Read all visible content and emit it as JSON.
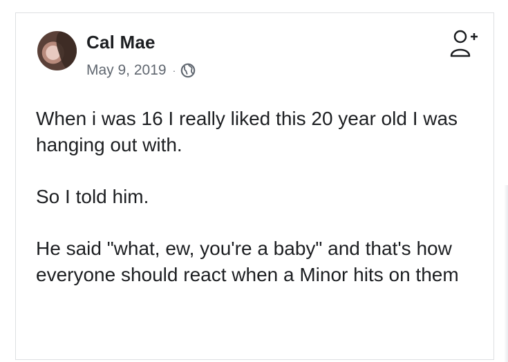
{
  "post": {
    "author": "Cal Mae",
    "date": "May 9, 2019",
    "separator": "·",
    "privacy_icon": "globe-icon",
    "action_icon": "add-friend-icon",
    "paragraphs": [
      "When i was 16 I really liked this 20 year old I was hanging out with.",
      "So I told him.",
      "He said \"what, ew, you're a baby\" and that's how everyone should react when a Minor hits on them"
    ]
  },
  "colors": {
    "text": "#1c1e21",
    "meta": "#606770",
    "border": "#dddfe2"
  }
}
